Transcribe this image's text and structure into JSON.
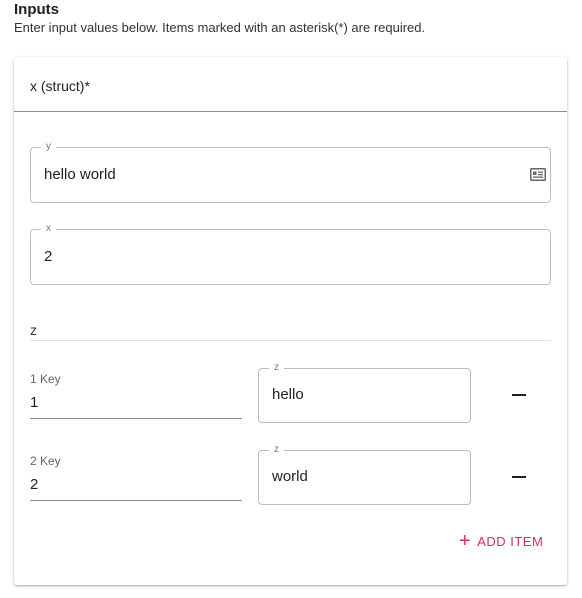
{
  "header": {
    "title": "Inputs",
    "subtitle": "Enter input values below. Items marked with an asterisk(*) are required."
  },
  "struct": {
    "label": "x (struct)*",
    "fields": [
      {
        "legend": "y",
        "value": "hello world",
        "icon": "card-icon"
      },
      {
        "legend": "x",
        "value": "2"
      }
    ],
    "map": {
      "label": "z",
      "items": [
        {
          "key_label": "1 Key",
          "key_value": "1",
          "value_legend": "z",
          "value": "hello"
        },
        {
          "key_label": "2 Key",
          "key_value": "2",
          "value_legend": "z",
          "value": "world"
        }
      ],
      "add_label": "ADD ITEM",
      "accent_color": "#d32f5f"
    }
  }
}
